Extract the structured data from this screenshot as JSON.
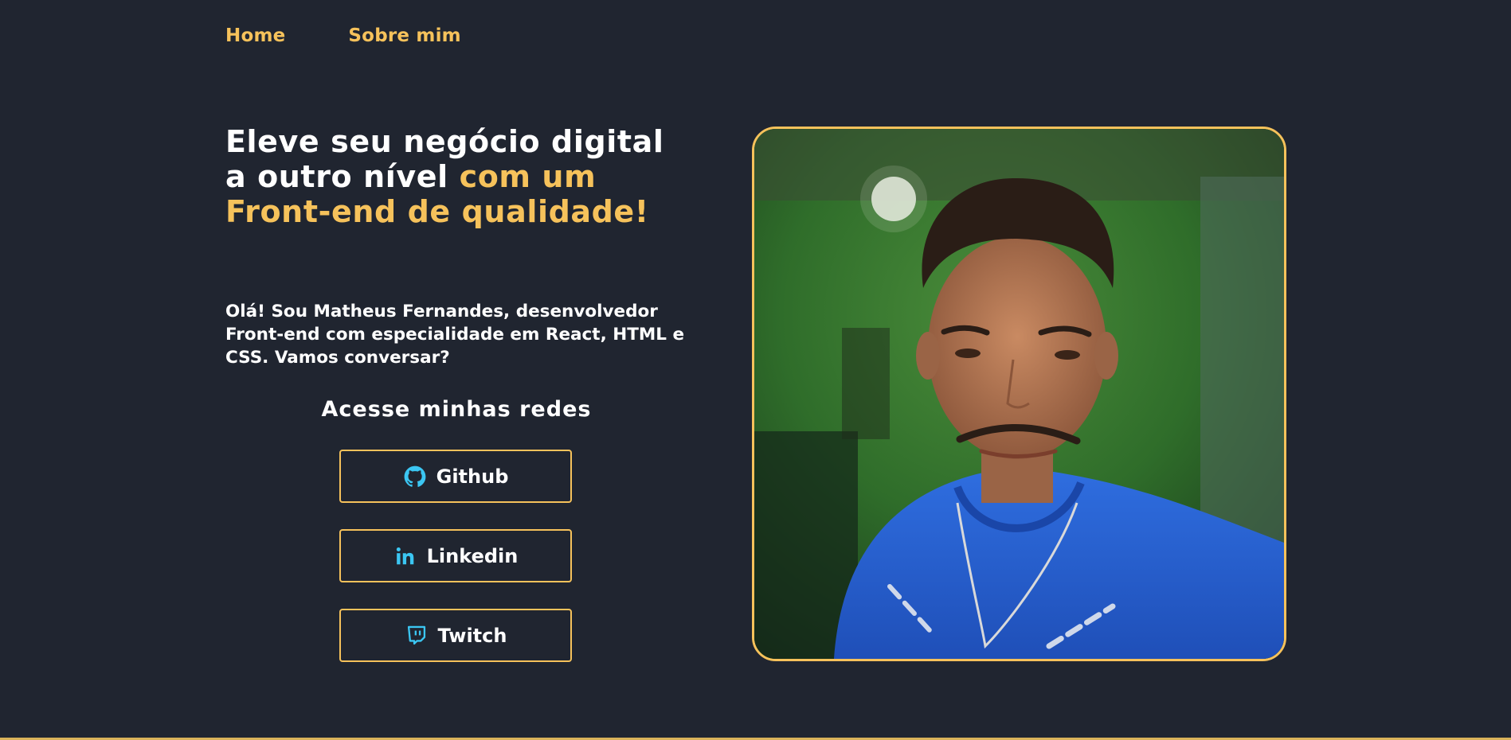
{
  "nav": {
    "home": "Home",
    "about": "Sobre mim"
  },
  "hero": {
    "title_white": "Eleve seu negócio digital a outro nível ",
    "title_accent": "com um Front-end de qualidade!",
    "intro": "Olá! Sou Matheus Fernandes, desenvolvedor Front-end com especialidade em React, HTML e CSS. Vamos conversar?"
  },
  "networks": {
    "title": "Acesse minhas redes",
    "buttons": [
      {
        "label": "Github",
        "icon": "github-icon"
      },
      {
        "label": "Linkedin",
        "icon": "linkedin-icon"
      },
      {
        "label": "Twitch",
        "icon": "twitch-icon"
      }
    ]
  },
  "colors": {
    "background": "#202530",
    "accent": "#F6C25B",
    "icon": "#3BC6F2",
    "text": "#FFFFFF"
  }
}
